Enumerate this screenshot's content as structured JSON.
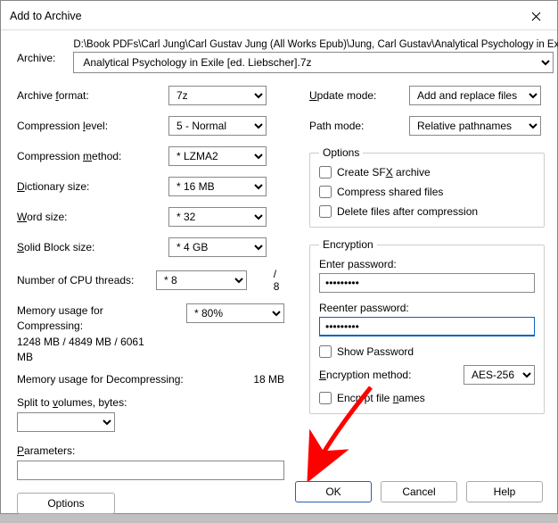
{
  "title": "Add to Archive",
  "archive_label": "Archive:",
  "archive_path": "D:\\Book PDFs\\Carl Jung\\Carl Gustav Jung (All Works Epub)\\Jung, Carl Gustav\\Analytical Psychology in Exile [ed.",
  "archive_file": "Analytical Psychology in Exile [ed. Liebscher].7z",
  "browse_btn": "...",
  "left": {
    "archive_format_label": "Archive format:",
    "archive_format_value": "7z",
    "compression_level_label": "Compression level:",
    "compression_level_value": "5 - Normal",
    "compression_method_label": "Compression method:",
    "compression_method_value": "* LZMA2",
    "dictionary_size_label": "Dictionary size:",
    "dictionary_size_value": "* 16 MB",
    "word_size_label": "Word size:",
    "word_size_value": "* 32",
    "solid_block_label": "Solid Block size:",
    "solid_block_value": "* 4 GB",
    "cpu_threads_label": "Number of CPU threads:",
    "cpu_threads_value": "* 8",
    "cpu_threads_total": "/ 8",
    "mem_compress_label": "Memory usage for Compressing:\n1248 MB / 4849 MB / 6061 MB",
    "mem_compress_value": "* 80%",
    "mem_decompress_label": "Memory usage for Decompressing:",
    "mem_decompress_value": "18 MB",
    "split_label": "Split to volumes, bytes:",
    "split_value": "",
    "parameters_label": "Parameters:",
    "parameters_value": "",
    "options_btn": "Options"
  },
  "right": {
    "update_mode_label": "Update mode:",
    "update_mode_value": "Add and replace files",
    "path_mode_label": "Path mode:",
    "path_mode_value": "Relative pathnames",
    "options_legend": "Options",
    "sfx_label": "Create SFX archive",
    "compress_shared_label": "Compress shared files",
    "delete_after_label": "Delete files after compression",
    "encryption_legend": "Encryption",
    "enter_password_label": "Enter password:",
    "enter_password_value": "•••••••••",
    "reenter_password_label": "Reenter password:",
    "reenter_password_value": "•••••••••",
    "show_password_label": "Show Password",
    "encryption_method_label": "Encryption method:",
    "encryption_method_value": "AES-256",
    "encrypt_filenames_label": "Encrypt file names"
  },
  "footer": {
    "ok": "OK",
    "cancel": "Cancel",
    "help": "Help"
  }
}
